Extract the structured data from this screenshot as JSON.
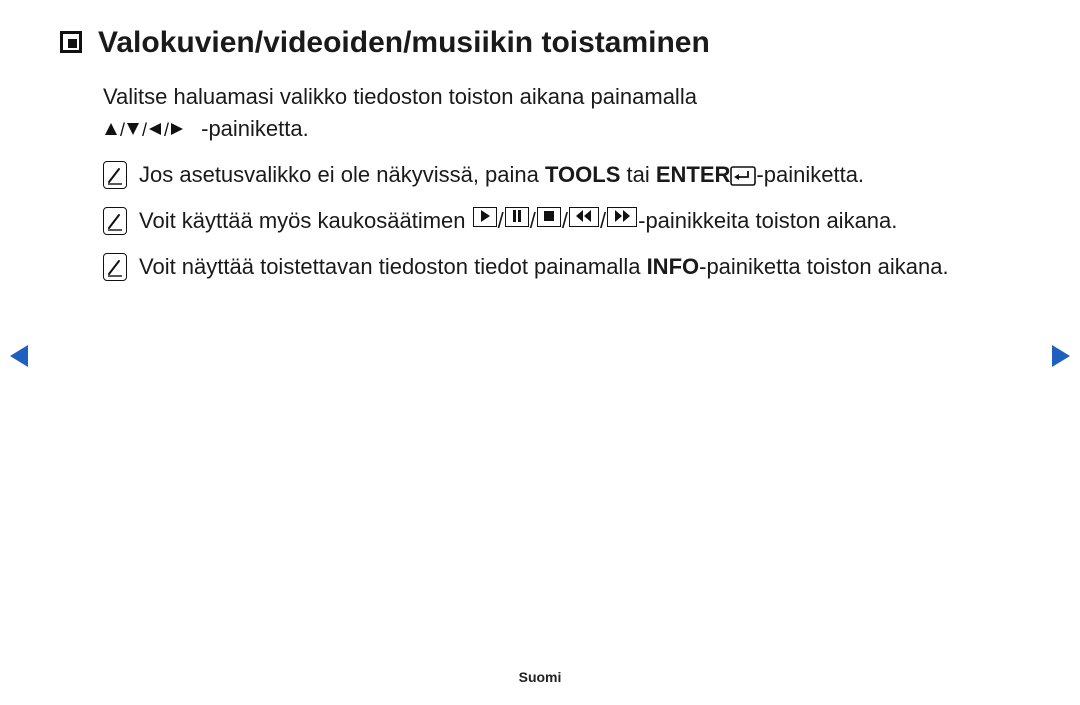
{
  "title": "Valokuvien/videoiden/musiikin toistaminen",
  "para1_a": "Valitse haluamasi valikko tiedoston toiston aikana painamalla",
  "para1_b": "-painiketta.",
  "note1_a": "Jos asetusvalikko ei ole näkyvissä, paina ",
  "note1_tools": "TOOLS",
  "note1_b": " tai ",
  "note1_enter": "ENTER",
  "note1_c": "-painiketta.",
  "note2_a": "Voit käyttää myös kaukosäätimen ",
  "note2_b": "-painikkeita toiston aikana.",
  "note3_a": "Voit näyttää toistettavan tiedoston tiedot painamalla ",
  "note3_info": "INFO",
  "note3_b": "-painiketta toiston aikana.",
  "footer": "Suomi"
}
